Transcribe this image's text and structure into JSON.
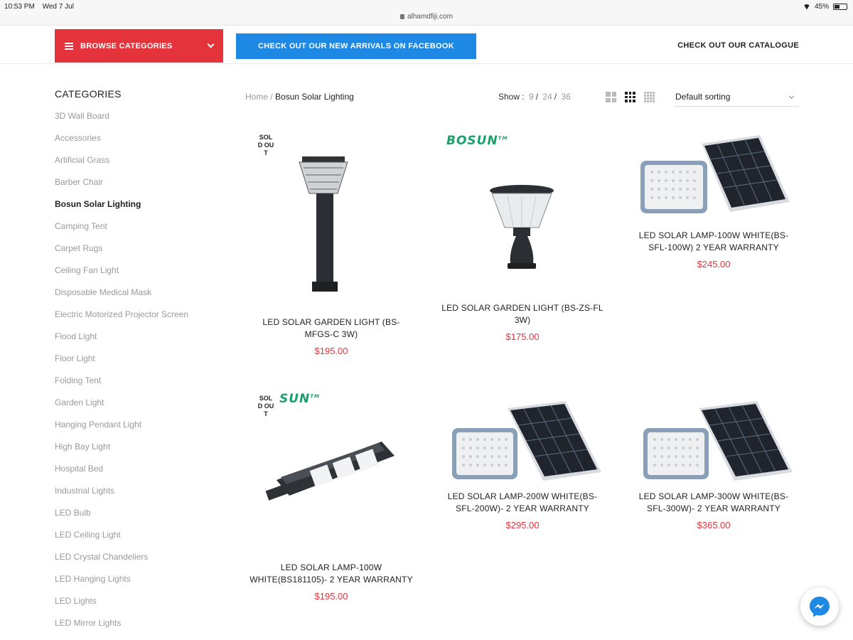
{
  "status_bar": {
    "time": "10:53 PM",
    "date": "Wed 7 Jul",
    "url": "alhamdfiji.com",
    "battery": "45%",
    "battery_level": 0.45
  },
  "header": {
    "browse_label": "BROWSE CATEGORIES",
    "facebook_label": "CHECK OUT OUR NEW ARRIVALS ON FACEBOOK",
    "catalogue_label": "CHECK OUT OUR CATALOGUE"
  },
  "sidebar": {
    "title": "CATEGORIES",
    "items": [
      "3D Wall Board",
      "Accessories",
      "Artificial Grass",
      "Barber Chair",
      "Bosun Solar Lighting",
      "Camping Tent",
      "Carpet Rugs",
      "Ceiling Fan Light",
      "Disposable Medical Mask",
      "Electric Motorized Projector Screen",
      "Flood Light",
      "Floor Light",
      "Folding Tent",
      "Garden Light",
      "Hanging Pendant Light",
      "High Bay Light",
      "Hospital Bed",
      "Industrial Lights",
      "LED Bulb",
      "LED Ceiling Light",
      "LED Crystal Chandeliers",
      "LED Hanging Lights",
      "LED Lights",
      "LED Mirror Lights"
    ],
    "active": "Bosun Solar Lighting"
  },
  "toolbar": {
    "breadcrumb_home": "Home",
    "breadcrumb_sep": "/",
    "breadcrumb_current": "Bosun Solar Lighting",
    "show_label": "Show :",
    "show_options": [
      "9",
      "24",
      "36"
    ],
    "sort_label": "Default sorting"
  },
  "products": [
    {
      "title": "LED SOLAR GARDEN LIGHT (BS-MFGS-C 3W)",
      "price": "$195.00",
      "badge": "SOLD OUT",
      "brand": ""
    },
    {
      "title": "LED SOLAR GARDEN LIGHT (BS-ZS-FL 3W)",
      "price": "$175.00",
      "badge": "",
      "brand": "BOSUN"
    },
    {
      "title": "LED SOLAR LAMP-100W WHITE(BS-SFL-100W) 2 YEAR WARRANTY",
      "price": "$245.00",
      "badge": "",
      "brand": ""
    },
    {
      "title": "LED SOLAR LAMP-100W WHITE(BS181105)- 2 YEAR WARRANTY",
      "price": "$195.00",
      "badge": "SOLD OUT",
      "brand": "SUN"
    },
    {
      "title": "LED SOLAR LAMP-200W WHITE(BS-SFL-200W)- 2 YEAR WARRANTY",
      "price": "$295.00",
      "badge": "",
      "brand": ""
    },
    {
      "title": "LED SOLAR LAMP-300W WHITE(BS-SFL-300W)- 2 YEAR WARRANTY",
      "price": "$365.00",
      "badge": "",
      "brand": ""
    }
  ],
  "colors": {
    "accent_red": "#e5333b",
    "facebook_blue": "#1e88e5",
    "brand_green": "#1aa06d"
  },
  "icons": [
    "menu-icon",
    "chevron-down-icon",
    "grid-2-icon",
    "grid-3-icon",
    "grid-4-icon",
    "messenger-icon",
    "wifi-icon",
    "battery-icon",
    "lock-icon"
  ]
}
